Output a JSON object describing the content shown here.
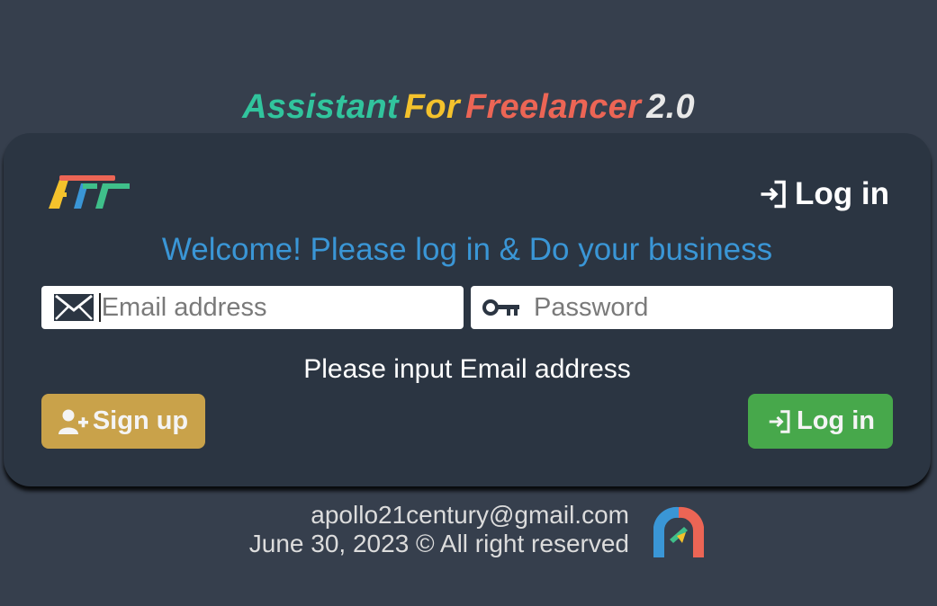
{
  "title": {
    "part1": "Assistant",
    "part2": "For",
    "part3": "Freelancer",
    "part4": "2.0",
    "colors": {
      "part1": "#31c49d",
      "part2": "#f4c22c",
      "part3": "#ec6555",
      "part4": "#e8e8e8"
    }
  },
  "logo": {
    "name": "AFF-logo",
    "colors": [
      "#f4c22c",
      "#ec6555",
      "#3fbf8a",
      "#3a96d6"
    ]
  },
  "header": {
    "login_label": "Log in",
    "icon": "login-icon"
  },
  "welcome": "Welcome! Please log in & Do your business",
  "form": {
    "email": {
      "placeholder": "Email address",
      "value": "",
      "icon": "envelope-icon"
    },
    "password": {
      "placeholder": "Password",
      "value": "",
      "icon": "key-icon"
    },
    "hint": "Please input Email address"
  },
  "buttons": {
    "signup": {
      "label": "Sign up",
      "icon": "add-user-icon",
      "color": "#c9a24a"
    },
    "login": {
      "label": "Log in",
      "icon": "login-icon",
      "color": "#47a84b"
    }
  },
  "footer": {
    "email": "apollo21century@gmail.com",
    "copyright": "June 30, 2023 © All right reserved",
    "logo": "apollo-logo"
  }
}
